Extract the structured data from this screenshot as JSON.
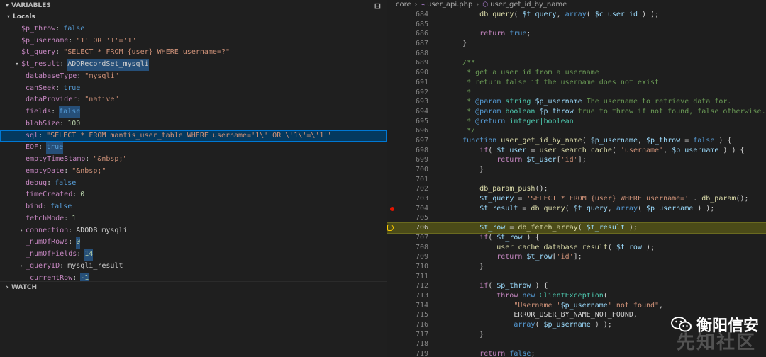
{
  "variables_panel": {
    "title": "VARIABLES",
    "locals_label": "Locals",
    "rows": [
      {
        "kind": "var",
        "indent": 1,
        "twisty": "",
        "name": "$p_throw",
        "value": "false",
        "vtype": "kw"
      },
      {
        "kind": "var",
        "indent": 1,
        "twisty": "",
        "name": "$p_username",
        "value": "\"1' OR '1'='1\"",
        "vtype": "str"
      },
      {
        "kind": "var",
        "indent": 1,
        "twisty": "",
        "name": "$t_query",
        "value": "\"SELECT * FROM {user} WHERE username=?\"",
        "vtype": "str"
      },
      {
        "kind": "var",
        "indent": 1,
        "twisty": "open",
        "name": "$t_result",
        "value": "ADORecordSet_mysqli",
        "vtype": "plain",
        "hl": true
      },
      {
        "kind": "var",
        "indent": 2,
        "twisty": "",
        "name": "databaseType",
        "value": "\"mysqli\"",
        "vtype": "str"
      },
      {
        "kind": "var",
        "indent": 2,
        "twisty": "",
        "name": "canSeek",
        "value": "true",
        "vtype": "kw"
      },
      {
        "kind": "var",
        "indent": 2,
        "twisty": "",
        "name": "dataProvider",
        "value": "\"native\"",
        "vtype": "str"
      },
      {
        "kind": "var",
        "indent": 2,
        "twisty": "",
        "name": "fields",
        "value": "false",
        "vtype": "kw",
        "hl": true
      },
      {
        "kind": "var",
        "indent": 2,
        "twisty": "",
        "name": "blobSize",
        "value": "100",
        "vtype": "num"
      },
      {
        "kind": "var",
        "indent": 2,
        "twisty": "",
        "name": "sql",
        "value": "\"SELECT * FROM mantis_user_table WHERE username='1\\' OR \\'1\\'=\\'1'\"",
        "vtype": "str",
        "selected": true
      },
      {
        "kind": "var",
        "indent": 2,
        "twisty": "",
        "name": "EOF",
        "value": "true",
        "vtype": "kw",
        "hl": true
      },
      {
        "kind": "var",
        "indent": 2,
        "twisty": "",
        "name": "emptyTimeStamp",
        "value": "\"&nbsp;\"",
        "vtype": "str"
      },
      {
        "kind": "var",
        "indent": 2,
        "twisty": "",
        "name": "emptyDate",
        "value": "\"&nbsp;\"",
        "vtype": "str"
      },
      {
        "kind": "var",
        "indent": 2,
        "twisty": "",
        "name": "debug",
        "value": "false",
        "vtype": "kw"
      },
      {
        "kind": "var",
        "indent": 2,
        "twisty": "",
        "name": "timeCreated",
        "value": "0",
        "vtype": "num"
      },
      {
        "kind": "var",
        "indent": 2,
        "twisty": "",
        "name": "bind",
        "value": "false",
        "vtype": "kw"
      },
      {
        "kind": "var",
        "indent": 2,
        "twisty": "",
        "name": "fetchMode",
        "value": "1",
        "vtype": "num"
      },
      {
        "kind": "var",
        "indent": 2,
        "twisty": "closed",
        "name": "connection",
        "value": "ADODB_mysqli",
        "vtype": "plain"
      },
      {
        "kind": "var",
        "indent": 2,
        "twisty": "",
        "name": "_numOfRows",
        "value": "0",
        "vtype": "num",
        "hl": true
      },
      {
        "kind": "var",
        "indent": 2,
        "twisty": "",
        "name": "_numOfFields",
        "value": "14",
        "vtype": "num",
        "hl": true
      },
      {
        "kind": "var",
        "indent": 2,
        "twisty": "closed",
        "name": "_queryID",
        "value": "mysqli_result",
        "vtype": "plain"
      },
      {
        "kind": "var",
        "indent": 2,
        "twisty": "",
        "name": "_currentRow",
        "value": "-1",
        "vtype": "num",
        "hl": true
      }
    ]
  },
  "watch_panel": {
    "title": "WATCH"
  },
  "editor": {
    "breadcrumbs": [
      "core",
      "user_api.php",
      "user_get_id_by_name"
    ],
    "current_line": 706,
    "breakpoint_line": 704,
    "lines": [
      {
        "n": 684,
        "t": [
          [
            "c-pl",
            "        "
          ],
          [
            "c-fn",
            "db_query"
          ],
          [
            "c-pl",
            "( "
          ],
          [
            "c-var",
            "$t_query"
          ],
          [
            "c-pl",
            ", "
          ],
          [
            "c-kw",
            "array"
          ],
          [
            "c-pl",
            "( "
          ],
          [
            "c-var",
            "$c_user_id"
          ],
          [
            "c-pl",
            " ) );"
          ]
        ]
      },
      {
        "n": 685,
        "t": []
      },
      {
        "n": 686,
        "t": [
          [
            "c-pl",
            "        "
          ],
          [
            "c-ctrl",
            "return"
          ],
          [
            "c-pl",
            " "
          ],
          [
            "c-kw",
            "true"
          ],
          [
            "c-pl",
            ";"
          ]
        ]
      },
      {
        "n": 687,
        "t": [
          [
            "c-pl",
            "    }"
          ]
        ]
      },
      {
        "n": 688,
        "t": []
      },
      {
        "n": 689,
        "t": [
          [
            "c-cm",
            "    /**"
          ]
        ]
      },
      {
        "n": 690,
        "t": [
          [
            "c-cm",
            "     * get a user id from a username"
          ]
        ]
      },
      {
        "n": 691,
        "t": [
          [
            "c-cm",
            "     * return false if the username does not exist"
          ]
        ]
      },
      {
        "n": 692,
        "t": [
          [
            "c-cm",
            "     *"
          ]
        ]
      },
      {
        "n": 693,
        "t": [
          [
            "c-cm",
            "     * "
          ],
          [
            "c-kw",
            "@param"
          ],
          [
            "c-cm",
            " "
          ],
          [
            "c-cls",
            "string"
          ],
          [
            "c-cm",
            " "
          ],
          [
            "c-var",
            "$p_username"
          ],
          [
            "c-cm",
            " The username to retrieve data for."
          ]
        ]
      },
      {
        "n": 694,
        "t": [
          [
            "c-cm",
            "     * "
          ],
          [
            "c-kw",
            "@param"
          ],
          [
            "c-cm",
            " "
          ],
          [
            "c-cls",
            "boolean"
          ],
          [
            "c-cm",
            " "
          ],
          [
            "c-var",
            "$p_throw"
          ],
          [
            "c-cm",
            " true to throw if not found, false otherwise."
          ]
        ]
      },
      {
        "n": 695,
        "t": [
          [
            "c-cm",
            "     * "
          ],
          [
            "c-kw",
            "@return"
          ],
          [
            "c-cm",
            " "
          ],
          [
            "c-cls",
            "integer|boolean"
          ]
        ]
      },
      {
        "n": 696,
        "t": [
          [
            "c-cm",
            "     */"
          ]
        ]
      },
      {
        "n": 697,
        "t": [
          [
            "c-pl",
            "    "
          ],
          [
            "c-kw",
            "function"
          ],
          [
            "c-pl",
            " "
          ],
          [
            "c-fn",
            "user_get_id_by_name"
          ],
          [
            "c-pl",
            "( "
          ],
          [
            "c-var",
            "$p_username"
          ],
          [
            "c-pl",
            ", "
          ],
          [
            "c-var",
            "$p_throw"
          ],
          [
            "c-pl",
            " = "
          ],
          [
            "c-kw",
            "false"
          ],
          [
            "c-pl",
            " ) {"
          ]
        ]
      },
      {
        "n": 698,
        "t": [
          [
            "c-pl",
            "        "
          ],
          [
            "c-ctrl",
            "if"
          ],
          [
            "c-pl",
            "( "
          ],
          [
            "c-var",
            "$t_user"
          ],
          [
            "c-pl",
            " = "
          ],
          [
            "c-fn",
            "user_search_cache"
          ],
          [
            "c-pl",
            "( "
          ],
          [
            "c-str",
            "'username'"
          ],
          [
            "c-pl",
            ", "
          ],
          [
            "c-var",
            "$p_username"
          ],
          [
            "c-pl",
            " ) ) {"
          ]
        ]
      },
      {
        "n": 699,
        "t": [
          [
            "c-pl",
            "            "
          ],
          [
            "c-ctrl",
            "return"
          ],
          [
            "c-pl",
            " "
          ],
          [
            "c-var",
            "$t_user"
          ],
          [
            "c-pl",
            "["
          ],
          [
            "c-str",
            "'id'"
          ],
          [
            "c-pl",
            "];"
          ]
        ]
      },
      {
        "n": 700,
        "t": [
          [
            "c-pl",
            "        }"
          ]
        ]
      },
      {
        "n": 701,
        "t": []
      },
      {
        "n": 702,
        "t": [
          [
            "c-pl",
            "        "
          ],
          [
            "c-fn",
            "db_param_push"
          ],
          [
            "c-pl",
            "();"
          ]
        ]
      },
      {
        "n": 703,
        "t": [
          [
            "c-pl",
            "        "
          ],
          [
            "c-var",
            "$t_query"
          ],
          [
            "c-pl",
            " = "
          ],
          [
            "c-str",
            "'SELECT * FROM {user} WHERE username='"
          ],
          [
            "c-pl",
            " . "
          ],
          [
            "c-fn",
            "db_param"
          ],
          [
            "c-pl",
            "();"
          ]
        ]
      },
      {
        "n": 704,
        "t": [
          [
            "c-pl",
            "        "
          ],
          [
            "c-var",
            "$t_result"
          ],
          [
            "c-pl",
            " = "
          ],
          [
            "c-fn",
            "db_query"
          ],
          [
            "c-pl",
            "( "
          ],
          [
            "c-var",
            "$t_query"
          ],
          [
            "c-pl",
            ", "
          ],
          [
            "c-kw",
            "array"
          ],
          [
            "c-pl",
            "( "
          ],
          [
            "c-var",
            "$p_username"
          ],
          [
            "c-pl",
            " ) );"
          ]
        ]
      },
      {
        "n": 705,
        "t": []
      },
      {
        "n": 706,
        "t": [
          [
            "c-pl",
            "        "
          ],
          [
            "c-var",
            "$t_row"
          ],
          [
            "c-pl",
            " = "
          ],
          [
            "c-fn",
            "db_fetch_array"
          ],
          [
            "c-pl",
            "( "
          ],
          [
            "c-var",
            "$t_result"
          ],
          [
            "c-pl",
            " );"
          ]
        ]
      },
      {
        "n": 707,
        "t": [
          [
            "c-pl",
            "        "
          ],
          [
            "c-ctrl",
            "if"
          ],
          [
            "c-pl",
            "( "
          ],
          [
            "c-var",
            "$t_row"
          ],
          [
            "c-pl",
            " ) {"
          ]
        ]
      },
      {
        "n": 708,
        "t": [
          [
            "c-pl",
            "            "
          ],
          [
            "c-fn",
            "user_cache_database_result"
          ],
          [
            "c-pl",
            "( "
          ],
          [
            "c-var",
            "$t_row"
          ],
          [
            "c-pl",
            " );"
          ]
        ]
      },
      {
        "n": 709,
        "t": [
          [
            "c-pl",
            "            "
          ],
          [
            "c-ctrl",
            "return"
          ],
          [
            "c-pl",
            " "
          ],
          [
            "c-var",
            "$t_row"
          ],
          [
            "c-pl",
            "["
          ],
          [
            "c-str",
            "'id'"
          ],
          [
            "c-pl",
            "];"
          ]
        ]
      },
      {
        "n": 710,
        "t": [
          [
            "c-pl",
            "        }"
          ]
        ]
      },
      {
        "n": 711,
        "t": []
      },
      {
        "n": 712,
        "t": [
          [
            "c-pl",
            "        "
          ],
          [
            "c-ctrl",
            "if"
          ],
          [
            "c-pl",
            "( "
          ],
          [
            "c-var",
            "$p_throw"
          ],
          [
            "c-pl",
            " ) {"
          ]
        ]
      },
      {
        "n": 713,
        "t": [
          [
            "c-pl",
            "            "
          ],
          [
            "c-ctrl",
            "throw"
          ],
          [
            "c-pl",
            " "
          ],
          [
            "c-kw",
            "new"
          ],
          [
            "c-pl",
            " "
          ],
          [
            "c-cls",
            "ClientException"
          ],
          [
            "c-pl",
            "("
          ]
        ]
      },
      {
        "n": 714,
        "t": [
          [
            "c-pl",
            "                "
          ],
          [
            "c-str",
            "\"Username '"
          ],
          [
            "c-var",
            "$p_username"
          ],
          [
            "c-str",
            "' not found\""
          ],
          [
            "c-pl",
            ","
          ]
        ]
      },
      {
        "n": 715,
        "t": [
          [
            "c-pl",
            "                "
          ],
          [
            "c-pl",
            "ERROR_USER_BY_NAME_NOT_FOUND"
          ],
          [
            "c-pl",
            ","
          ]
        ]
      },
      {
        "n": 716,
        "t": [
          [
            "c-pl",
            "                "
          ],
          [
            "c-kw",
            "array"
          ],
          [
            "c-pl",
            "( "
          ],
          [
            "c-var",
            "$p_username"
          ],
          [
            "c-pl",
            " ) );"
          ]
        ]
      },
      {
        "n": 717,
        "t": [
          [
            "c-pl",
            "        }"
          ]
        ]
      },
      {
        "n": 718,
        "t": []
      },
      {
        "n": 719,
        "t": [
          [
            "c-pl",
            "        "
          ],
          [
            "c-ctrl",
            "return"
          ],
          [
            "c-pl",
            " "
          ],
          [
            "c-kw",
            "false"
          ],
          [
            "c-pl",
            ";"
          ]
        ]
      }
    ]
  },
  "watermark": {
    "title": "衡阳信安",
    "subtitle": "先知社区",
    "icon": "wechat-icon"
  }
}
